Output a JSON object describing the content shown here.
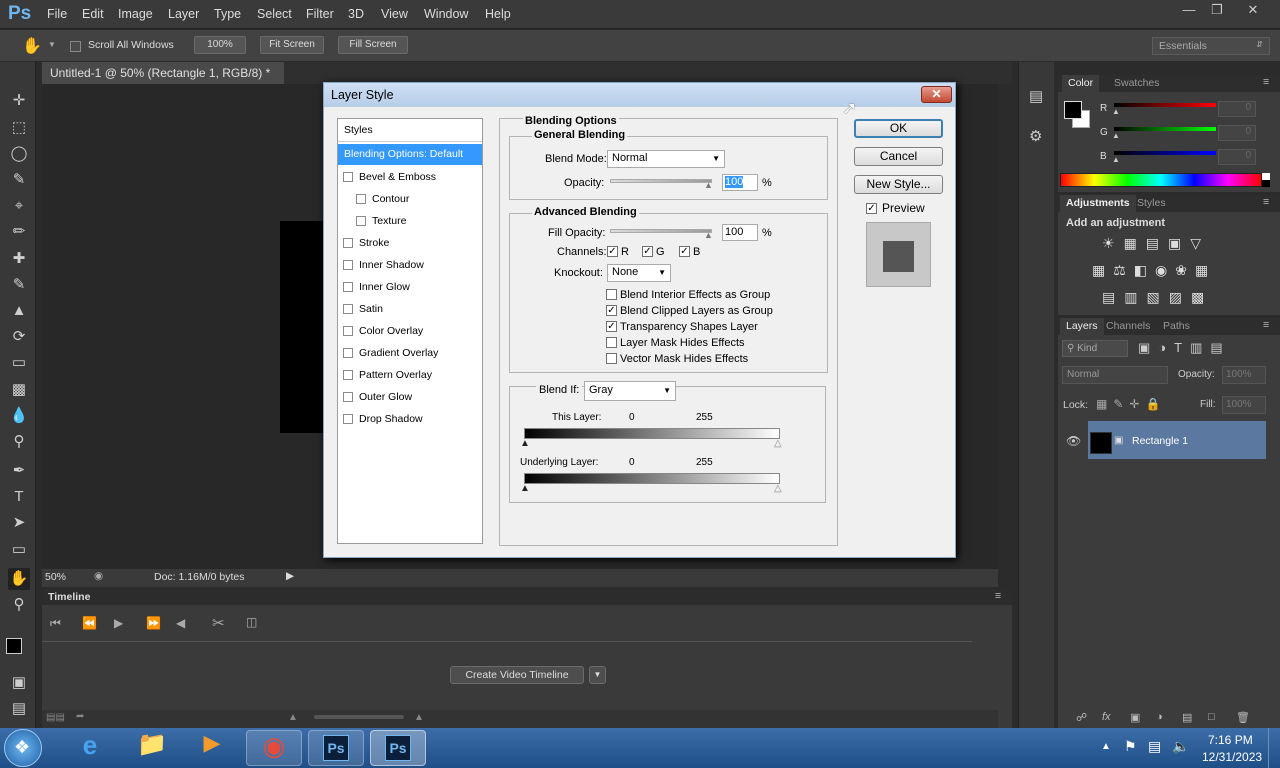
{
  "app": {
    "logo": "Ps"
  },
  "menu": [
    "File",
    "Edit",
    "Image",
    "Layer",
    "Type",
    "Select",
    "Filter",
    "3D",
    "View",
    "Window",
    "Help"
  ],
  "options": {
    "scroll_all": "Scroll All Windows",
    "zoom_btn": "100%",
    "fit_screen": "Fit Screen",
    "fill_screen": "Fill Screen",
    "workspace": "Essentials"
  },
  "document": {
    "tab_title": "Untitled-1 @ 50% (Rectangle 1, RGB/8) *",
    "zoom": "50%",
    "doc_info": "Doc: 1.16M/0 bytes"
  },
  "timeline": {
    "title": "Timeline",
    "create_btn": "Create Video Timeline"
  },
  "color_panel": {
    "tab1": "Color",
    "tab2": "Swatches",
    "r": "R",
    "g": "G",
    "b": "B",
    "r_val": "0",
    "g_val": "0",
    "b_val": "0"
  },
  "adjust_panel": {
    "tab1": "Adjustments",
    "tab2": "Styles",
    "heading": "Add an adjustment"
  },
  "layers_panel": {
    "tab1": "Layers",
    "tab2": "Channels",
    "tab3": "Paths",
    "kind": "Kind",
    "mode": "Normal",
    "opacity_lbl": "Opacity:",
    "opacity_val": "100%",
    "lock_lbl": "Lock:",
    "fill_lbl": "Fill:",
    "fill_val": "100%",
    "layer_name": "Rectangle 1"
  },
  "dialog": {
    "title": "Layer Style",
    "styles_header": "Styles",
    "styles": [
      {
        "label": "Blending Options: Default",
        "selected": true
      },
      {
        "label": "Bevel & Emboss",
        "check": true
      },
      {
        "label": "Contour",
        "check": true,
        "indent": true
      },
      {
        "label": "Texture",
        "check": true,
        "indent": true
      },
      {
        "label": "Stroke",
        "check": true
      },
      {
        "label": "Inner Shadow",
        "check": true
      },
      {
        "label": "Inner Glow",
        "check": true
      },
      {
        "label": "Satin",
        "check": true
      },
      {
        "label": "Color Overlay",
        "check": true
      },
      {
        "label": "Gradient Overlay",
        "check": true
      },
      {
        "label": "Pattern Overlay",
        "check": true
      },
      {
        "label": "Outer Glow",
        "check": true
      },
      {
        "label": "Drop Shadow",
        "check": true
      }
    ],
    "blending_options": "Blending Options",
    "general_blending": "General Blending",
    "blend_mode_lbl": "Blend Mode:",
    "blend_mode_val": "Normal",
    "opacity_lbl": "Opacity:",
    "opacity_val": "100",
    "pct": "%",
    "advanced_blending": "Advanced Blending",
    "fill_opacity_lbl": "Fill Opacity:",
    "fill_opacity_val": "100",
    "channels_lbl": "Channels:",
    "ch_r": "R",
    "ch_g": "G",
    "ch_b": "B",
    "knockout_lbl": "Knockout:",
    "knockout_val": "None",
    "checks": [
      {
        "label": "Blend Interior Effects as Group",
        "checked": false
      },
      {
        "label": "Blend Clipped Layers as Group",
        "checked": true
      },
      {
        "label": "Transparency Shapes Layer",
        "checked": true
      },
      {
        "label": "Layer Mask Hides Effects",
        "checked": false
      },
      {
        "label": "Vector Mask Hides Effects",
        "checked": false
      }
    ],
    "blend_if_lbl": "Blend If:",
    "blend_if_val": "Gray",
    "this_layer_lbl": "This Layer:",
    "this_layer_min": "0",
    "this_layer_max": "255",
    "underlying_lbl": "Underlying Layer:",
    "underlying_min": "0",
    "underlying_max": "255",
    "ok": "OK",
    "cancel": "Cancel",
    "new_style": "New Style...",
    "preview": "Preview"
  },
  "clock": {
    "time": "7:16 PM",
    "date": "12/31/2023"
  }
}
